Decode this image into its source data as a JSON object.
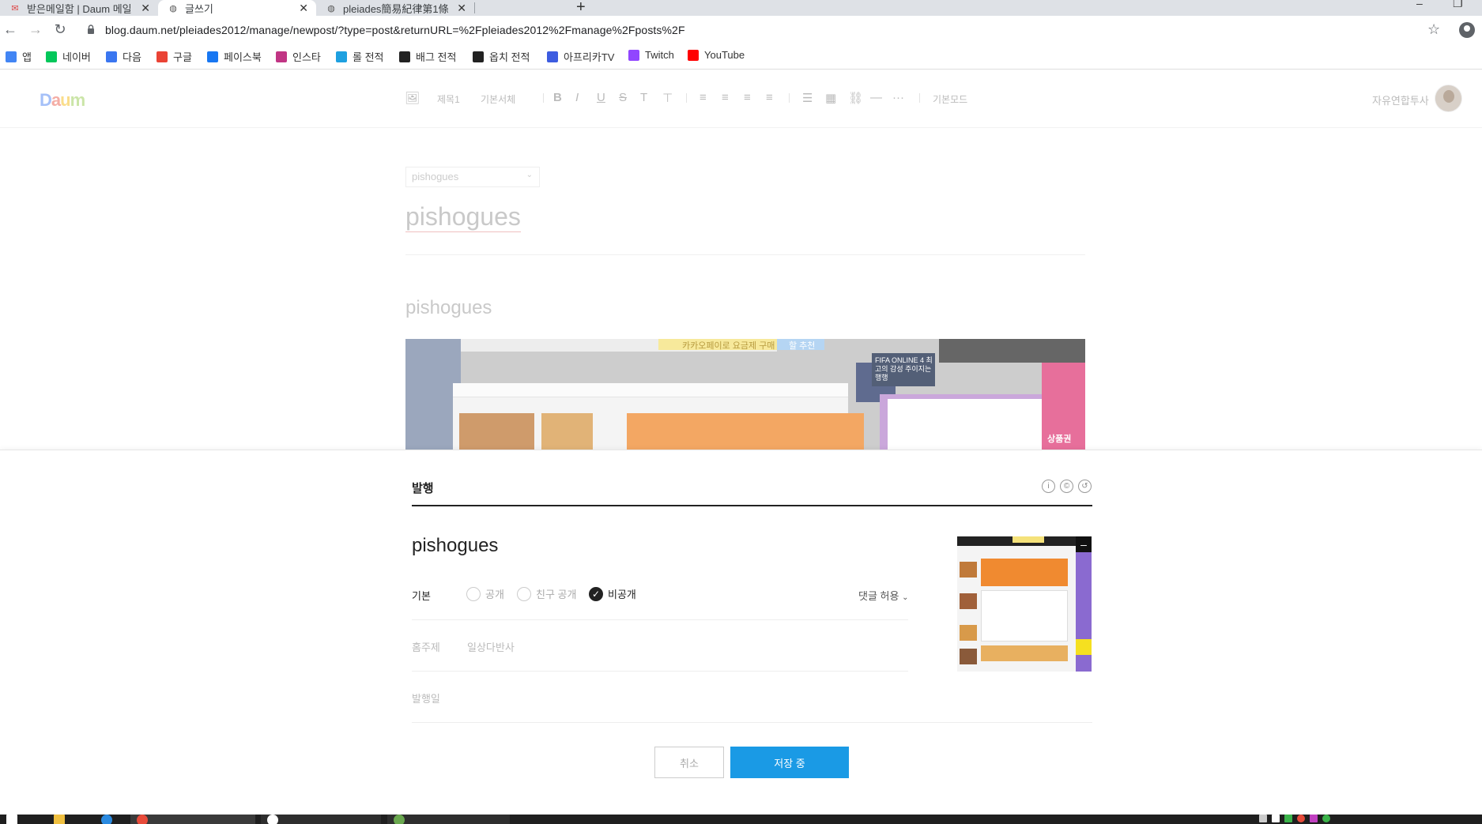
{
  "browser": {
    "tabs": [
      {
        "title": "받은메일함 | Daum 메일"
      },
      {
        "title": "글쓰기"
      },
      {
        "title": "pleiades簡易紀律第1條"
      }
    ],
    "url": "blog.daum.net/pleiades2012/manage/newpost/?type=post&returnURL=%2Fpleiades2012%2Fmanage%2Fposts%2F",
    "bookmarks": [
      {
        "label": "앱",
        "color": "#4285f4"
      },
      {
        "label": "네이버",
        "color": "#03c75a"
      },
      {
        "label": "다음",
        "color": "#3a76f0"
      },
      {
        "label": "구글",
        "color": "#ea4335"
      },
      {
        "label": "페이스북",
        "color": "#1877f2"
      },
      {
        "label": "인스타",
        "color": "#c13584"
      },
      {
        "label": "롤 전적",
        "color": "#1ea0e0"
      },
      {
        "label": "배그 전적",
        "color": "#222222"
      },
      {
        "label": "옵치 전적",
        "color": "#222222"
      },
      {
        "label": "아프리카TV",
        "color": "#3d5ce0"
      },
      {
        "label": "Twitch",
        "color": "#9146ff"
      },
      {
        "label": "YouTube",
        "color": "#ff0000"
      }
    ]
  },
  "editor": {
    "logo": "Daum",
    "toolbar": {
      "heading": "제목1",
      "font": "기본서체",
      "mode": "기본모드"
    },
    "blog_name": "자유연합투사",
    "category": "pishogues",
    "post_title": "pishogues",
    "body_text": "pishogues",
    "image_caption_1": "카카오페이로 요금제 구매",
    "image_caption_2": "할 추천",
    "image_promo": "FIFA ONLINE 4 최고의 감성 주이지는 행행",
    "image_label": "상품권"
  },
  "publish": {
    "header": "발행",
    "title": "pishogues",
    "visibility_label": "기본",
    "options": [
      {
        "label": "공개",
        "checked": false
      },
      {
        "label": "친구 공개",
        "checked": false
      },
      {
        "label": "비공개",
        "checked": true
      }
    ],
    "comment_setting": "댓글 허용",
    "subject_label": "홈주제",
    "subject_value": "일상다반사",
    "date_label": "발행일",
    "cancel_label": "취소",
    "save_label": "저장 중",
    "accent": "#1a9ae5"
  }
}
